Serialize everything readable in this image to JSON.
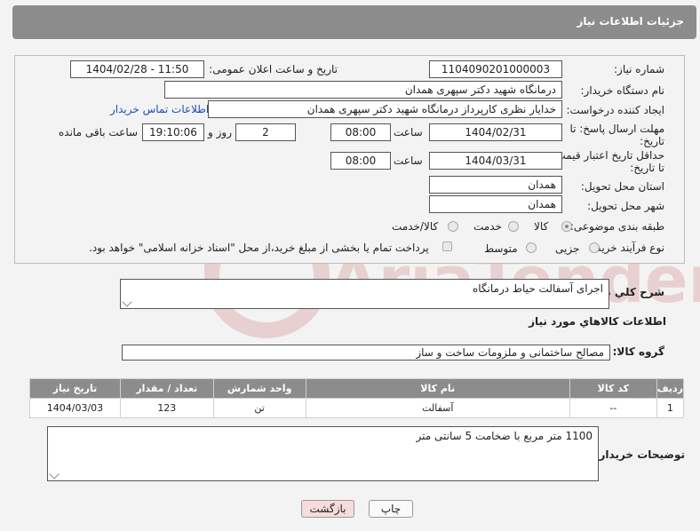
{
  "header": {
    "title": "جزئیات اطلاعات نیاز"
  },
  "fields": {
    "need_number_label": "شماره نیاز:",
    "need_number": "1104090201000003",
    "announce_label": "تاریخ و ساعت اعلان عمومی:",
    "announce_value": "1404/02/28 - 11:50",
    "buyer_org_label": "نام دستگاه خریدار:",
    "buyer_org": "درمانگاه شهید دکتر سپهری همدان",
    "creator_label": "ایجاد کننده درخواست:",
    "creator": "خدایار نظری کارپرداز درمانگاه شهید دکتر سپهری همدان",
    "contact_link": "اطلاعات تماس خریدار",
    "reply_deadline_label": "مهلت ارسال پاسخ: تا تاریخ:",
    "reply_date": "1404/02/31",
    "time_label": "ساعت",
    "reply_time": "08:00",
    "days": "2",
    "days_label": "روز و",
    "remaining_time": "19:10:06",
    "remaining_label": "ساعت باقی مانده",
    "price_deadline_label": "حداقل تاریخ اعتبار قیمت: تا تاریخ:",
    "price_date": "1404/03/31",
    "price_time": "08:00",
    "province_label": "استان محل تحویل:",
    "province": "همدان",
    "city_label": "شهر محل تحویل:",
    "city": "همدان",
    "category_label": "طبقه بندی موضوعی:",
    "category_options": [
      "کالا",
      "خدمت",
      "کالا/خدمت"
    ],
    "process_label": "نوع فرآیند خرید :",
    "process_options": [
      "جزیی",
      "متوسط"
    ],
    "payment_note": "پرداخت تمام یا بخشی از مبلغ خرید،از محل \"اسناد خزانه اسلامی\" خواهد بود."
  },
  "description": {
    "label": "شرح کلي نياز:",
    "value": "اجرای آسفالت حیاط درمانگاه"
  },
  "goods": {
    "section_title": "اطلاعات کالاهاي مورد نياز",
    "group_label": "گروه کالا:",
    "group_value": "مصالح ساختمانی و ملزومات ساخت و ساز",
    "columns": [
      "ردیف",
      "کد کالا",
      "نام کالا",
      "واحد شمارش",
      "تعداد / مقدار",
      "تاریخ نیاز"
    ],
    "rows": [
      {
        "row": "1",
        "code": "--",
        "name": "آسفالت",
        "unit": "تن",
        "qty": "123",
        "date": "1404/03/03"
      }
    ]
  },
  "buyer_notes": {
    "label": "توضیحات خریدار:",
    "value": "1100 متر مربع با ضخامت 5 سانتی متر"
  },
  "buttons": {
    "print": "چاپ",
    "back": "بازگشت"
  },
  "watermark": {
    "text": "AriaTender.neT"
  },
  "colors": {
    "header_bg": "#8c8c8c",
    "link": "#1a4fb5",
    "back_button_bg": "#f6dcdc"
  }
}
